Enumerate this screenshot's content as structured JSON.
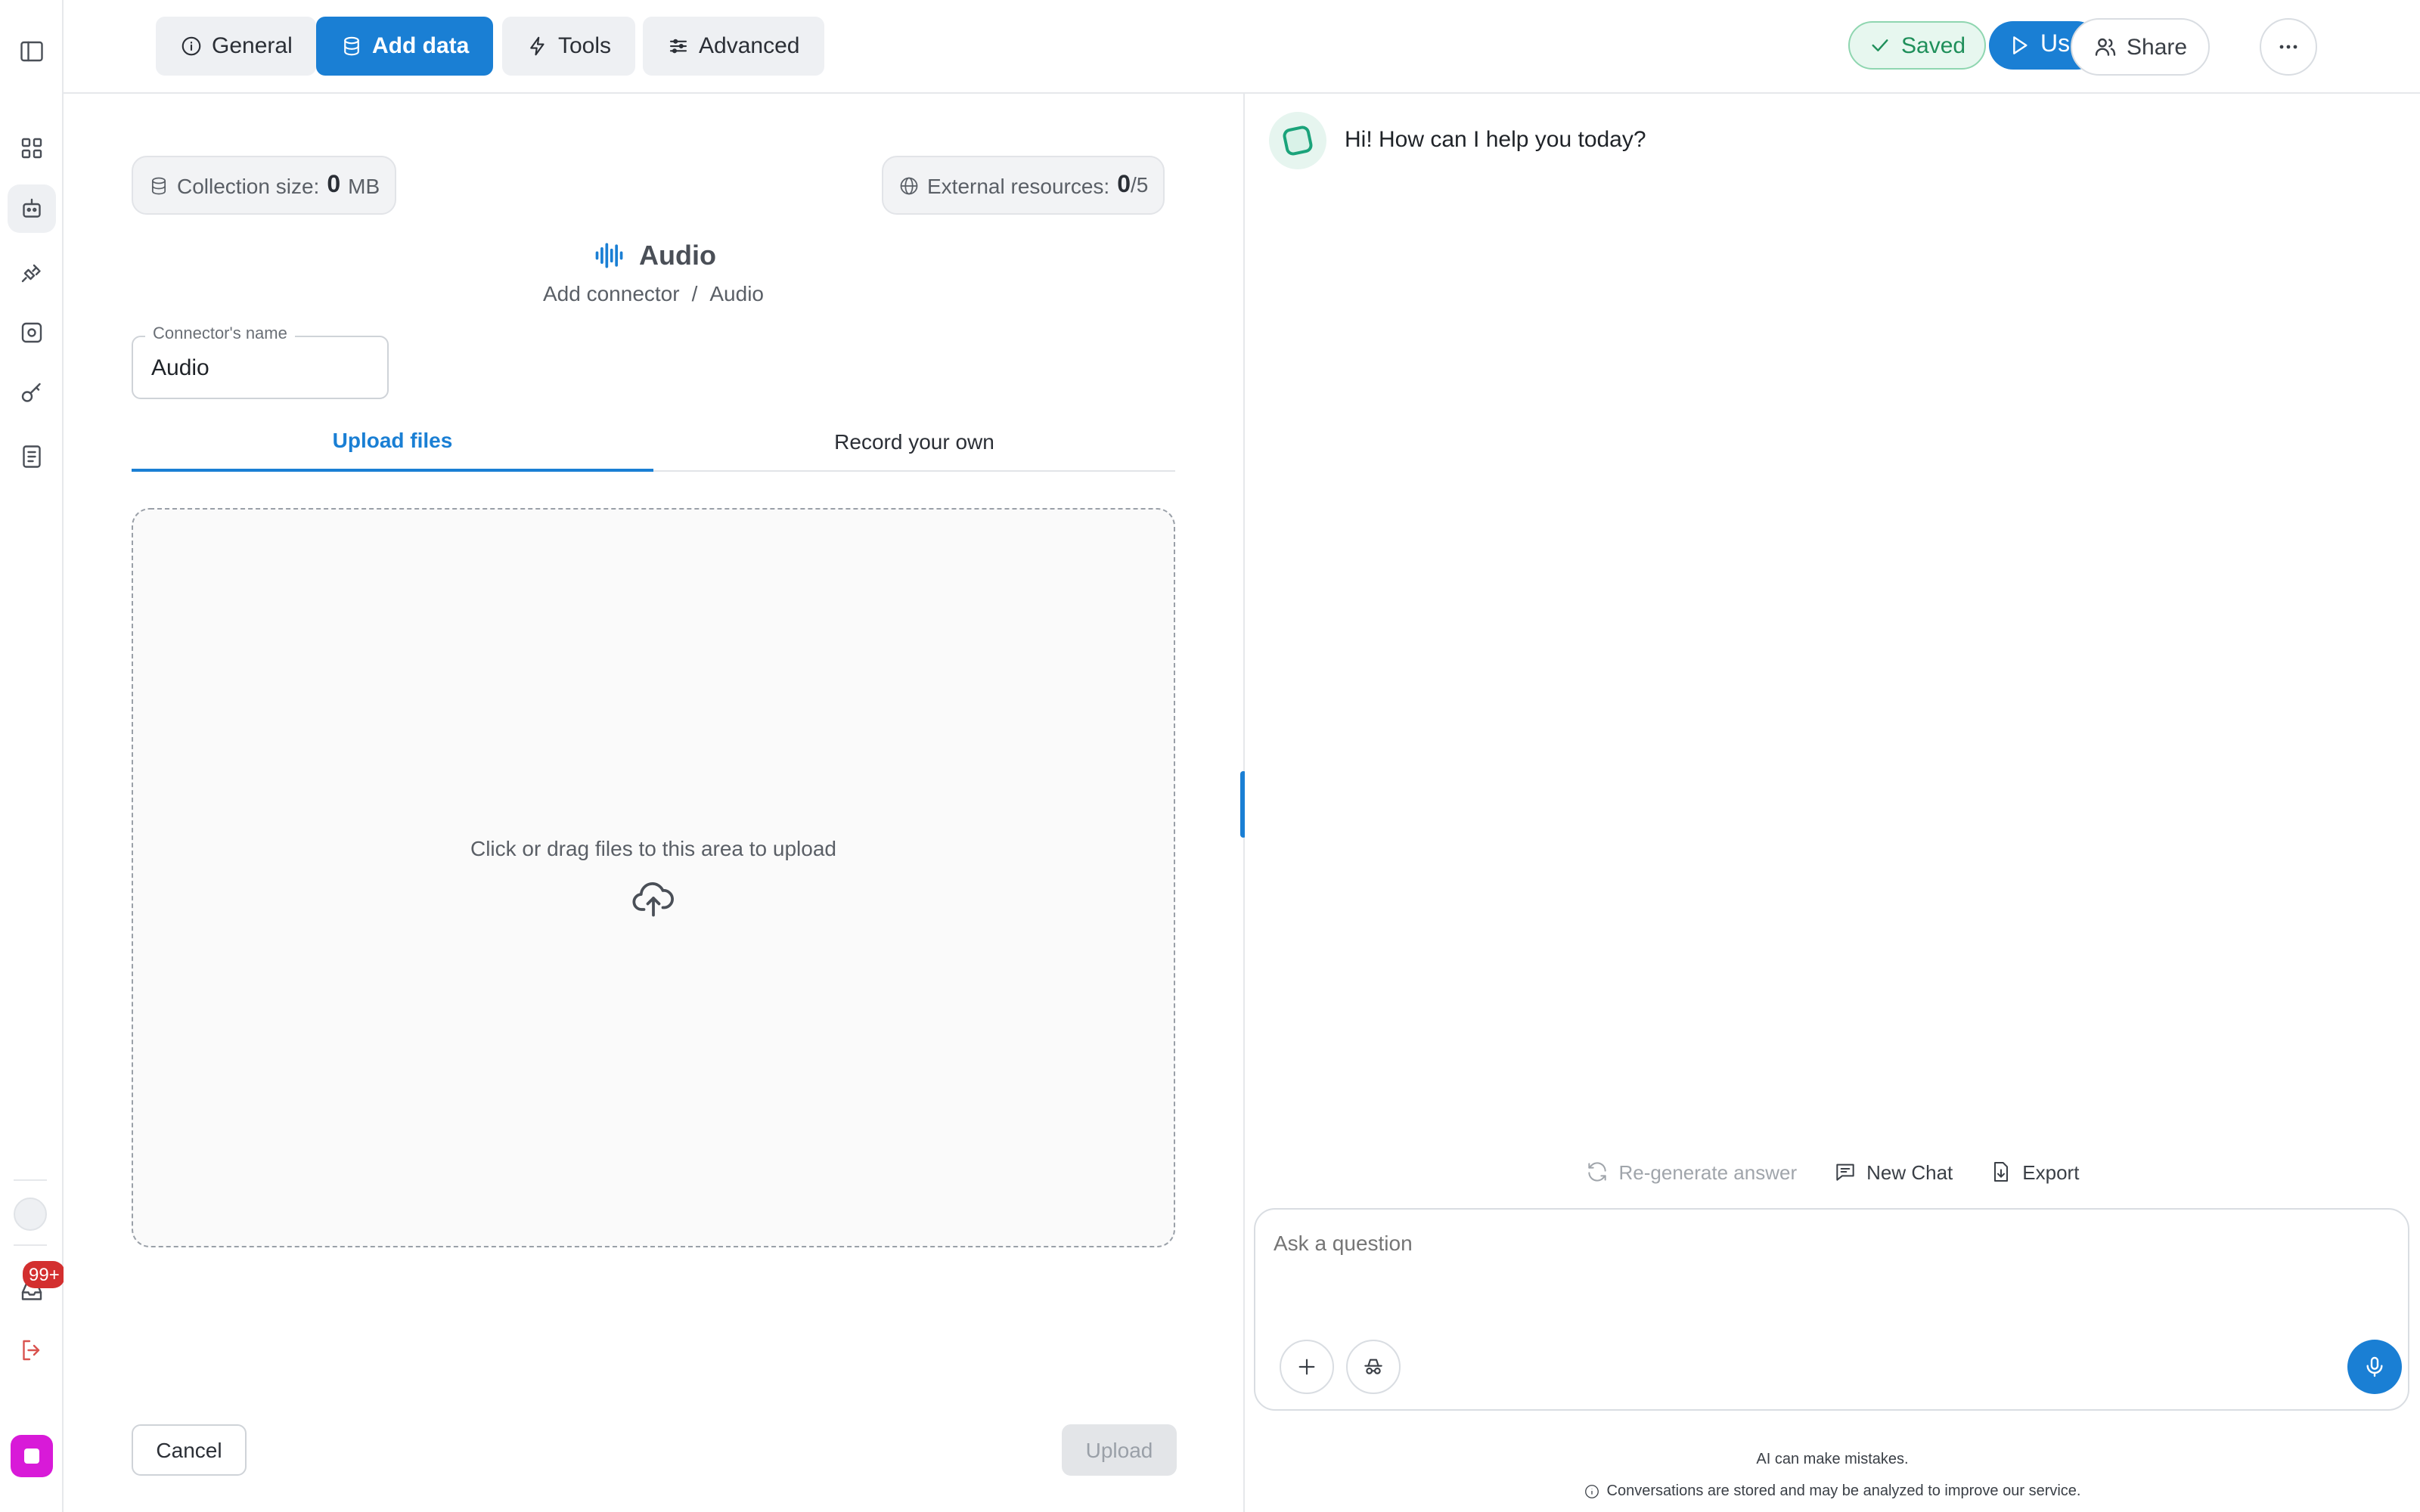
{
  "topbar": {
    "tabs": [
      {
        "label": "General",
        "icon": "info-icon"
      },
      {
        "label": "Add data",
        "icon": "database-icon"
      },
      {
        "label": "Tools",
        "icon": "lightning-icon"
      },
      {
        "label": "Advanced",
        "icon": "sliders-icon"
      }
    ],
    "active_tab": "Add data",
    "saved_label": "Saved",
    "use_label": "Use",
    "share_label": "Share"
  },
  "stats": {
    "collection_label": "Collection size:",
    "collection_value": "0",
    "collection_unit": "MB",
    "external_label": "External resources:",
    "external_value": "0",
    "external_max": "/5"
  },
  "connector": {
    "title": "Audio",
    "breadcrumb": [
      "Add connector",
      "Audio"
    ],
    "name_label": "Connector's name",
    "name_value": "Audio"
  },
  "upload_tabs": [
    {
      "label": "Upload files",
      "active": true
    },
    {
      "label": "Record your own",
      "active": false
    }
  ],
  "dropzone": {
    "text": "Click or drag files to this area to upload"
  },
  "footer": {
    "cancel_label": "Cancel",
    "upload_label": "Upload"
  },
  "rail": {
    "notification_count": "99+"
  },
  "chat": {
    "greeting": "Hi! How can I help you today?",
    "actions": {
      "regenerate": "Re-generate answer",
      "new_chat": "New Chat",
      "export": "Export"
    },
    "input_placeholder": "Ask a question",
    "disclaimer": "AI can make mistakes.",
    "storage_note": "Conversations are stored and may be analyzed to improve our service."
  },
  "colors": {
    "accent": "#1a7fd4",
    "saved_green": "#1f8f5a",
    "badge_red": "#d32f2f",
    "app_logo": "#d81ad8"
  }
}
